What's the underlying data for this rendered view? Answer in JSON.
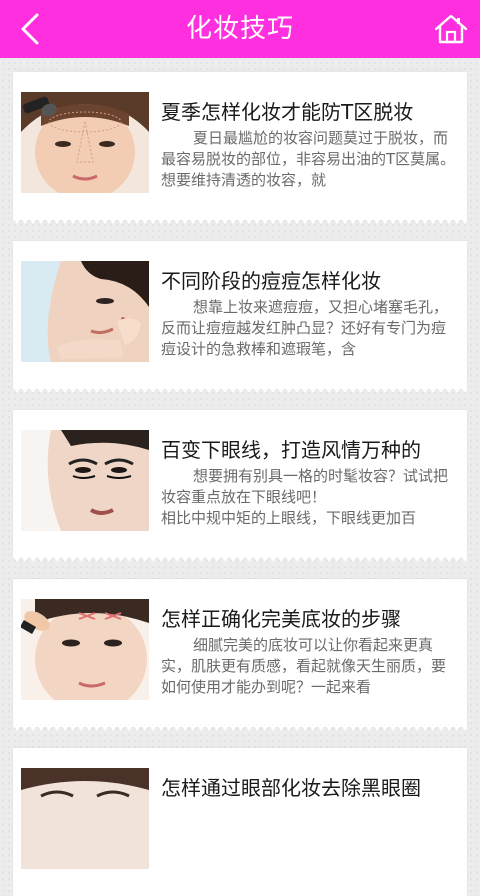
{
  "header": {
    "title": "化妆技巧",
    "back_icon": "back-chevron-icon",
    "home_icon": "home-icon",
    "background": "#ff2fe0"
  },
  "articles": [
    {
      "title": "夏季怎样化妆才能防T区脱妆",
      "excerpt": "夏日最尴尬的妆容问题莫过于脱妆，而最容易脱妆的部位，非容易出油的T区莫属。想要维持清透的妆容，就"
    },
    {
      "title": "不同阶段的痘痘怎样化妆",
      "excerpt": "想靠上妆来遮痘痘，又担心堵塞毛孔，反而让痘痘越发红肿凸显？还好有专门为痘痘设计的急救棒和遮瑕笔，含"
    },
    {
      "title": "百变下眼线，打造风情万种的",
      "excerpt": "想要拥有别具一格的时髦妆容？试试把妆容重点放在下眼线吧！",
      "excerpt2": "相比中规中矩的上眼线，下眼线更加百"
    },
    {
      "title": "怎样正确化完美底妆的步骤",
      "excerpt": "细腻完美的底妆可以让你看起来更真实，肌肤更有质感，看起就像天生丽质，要如何使用才能办到呢？一起来看"
    },
    {
      "title": "怎样通过眼部化妆去除黑眼圈",
      "excerpt": ""
    }
  ]
}
